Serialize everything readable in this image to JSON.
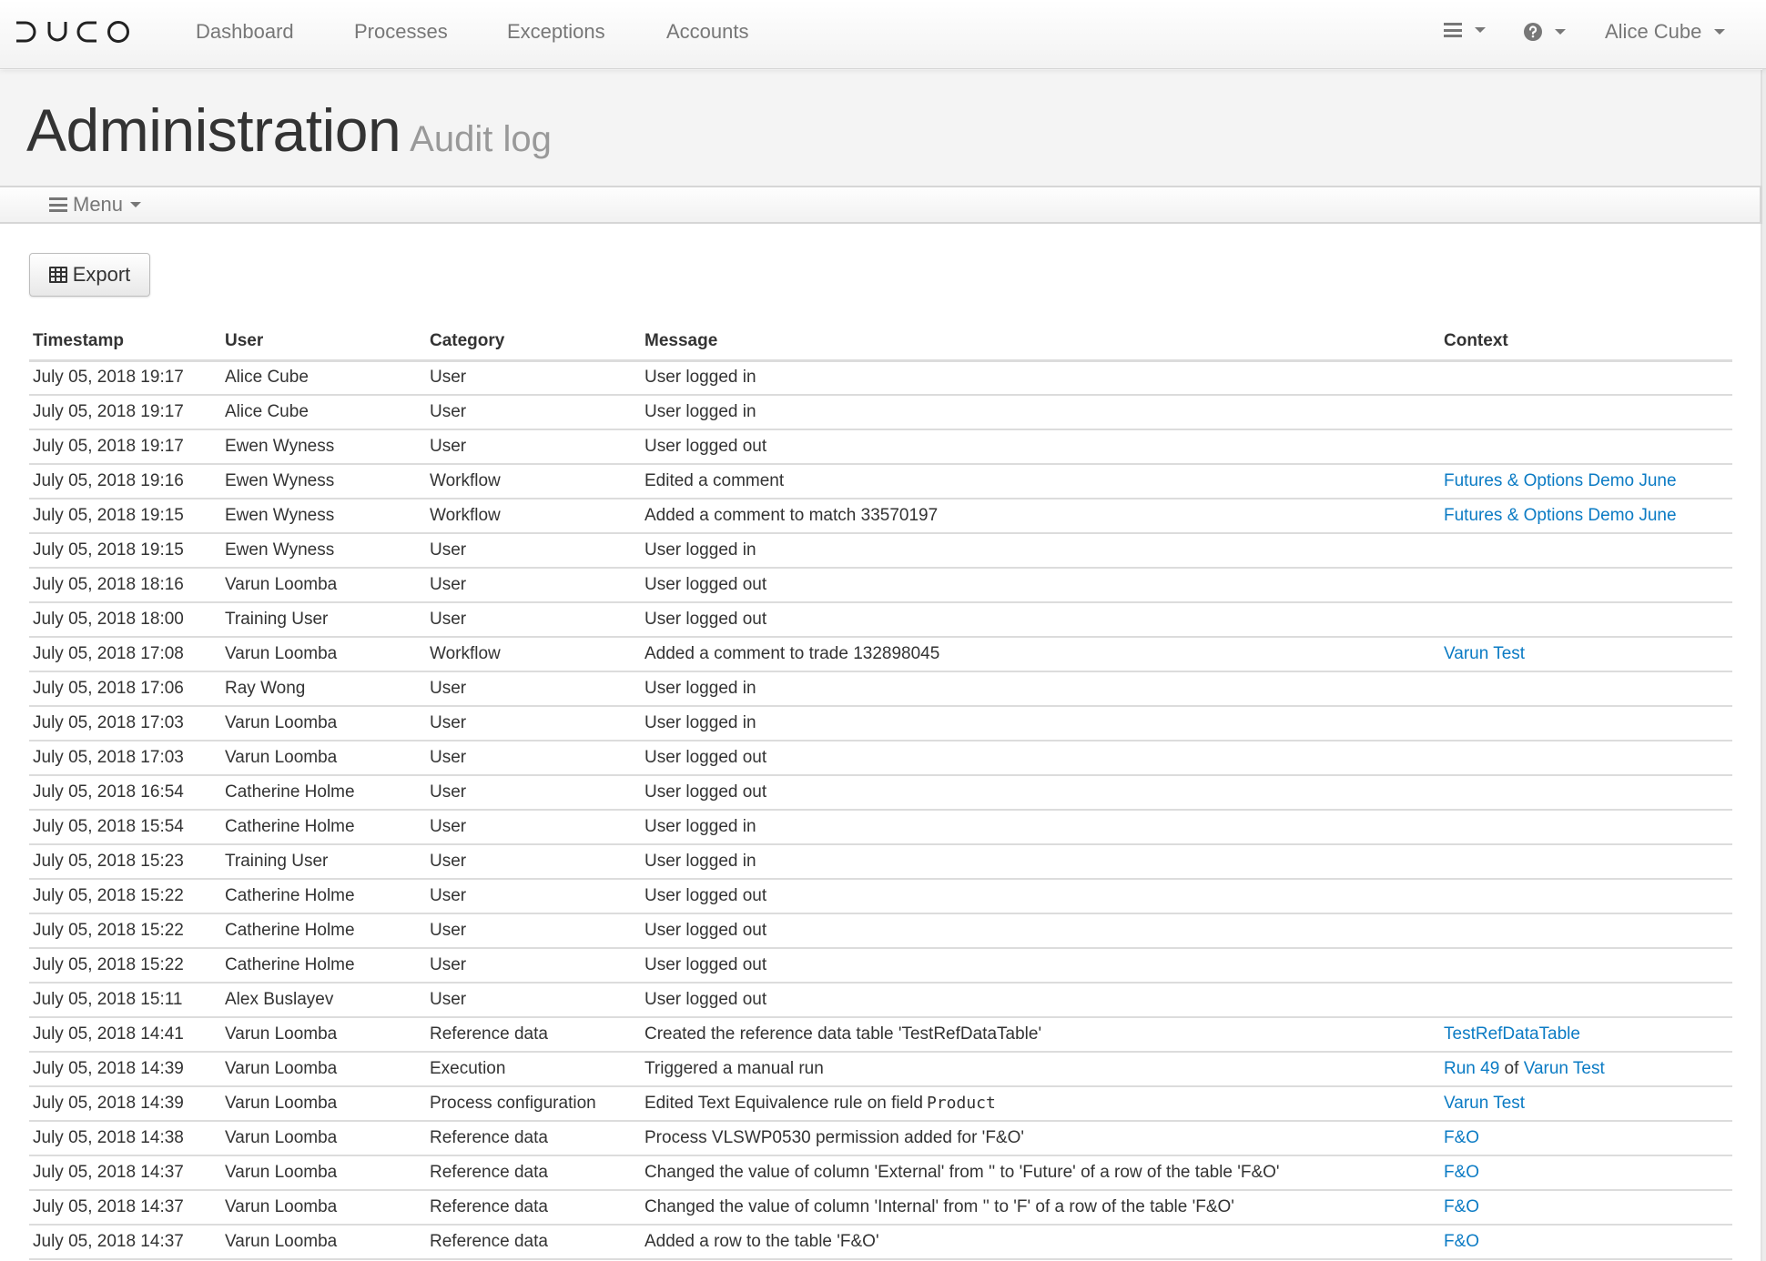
{
  "navbar": {
    "logo": "DUCO",
    "items": [
      "Dashboard",
      "Processes",
      "Exceptions",
      "Accounts"
    ],
    "right": {
      "menu_icon": "hamburger-icon",
      "help_icon": "question-circle-icon",
      "user_name": "Alice Cube"
    }
  },
  "page": {
    "title": "Administration",
    "subtitle": "Audit log"
  },
  "menubar": {
    "label": "Menu"
  },
  "toolbar": {
    "export_label": "Export",
    "export_icon": "table-icon"
  },
  "colors": {
    "link": "#0b7bc4",
    "text": "#333333",
    "nav_text": "#777777"
  },
  "table": {
    "columns": [
      "Timestamp",
      "User",
      "Category",
      "Message",
      "Context"
    ],
    "rows": [
      {
        "timestamp": "July 05, 2018 19:17",
        "user": "Alice Cube",
        "category": "User",
        "message": "User logged in",
        "context": []
      },
      {
        "timestamp": "July 05, 2018 19:17",
        "user": "Alice Cube",
        "category": "User",
        "message": "User logged in",
        "context": []
      },
      {
        "timestamp": "July 05, 2018 19:17",
        "user": "Ewen Wyness",
        "category": "User",
        "message": "User logged out",
        "context": []
      },
      {
        "timestamp": "July 05, 2018 19:16",
        "user": "Ewen Wyness",
        "category": "Workflow",
        "message": "Edited a comment",
        "context": [
          {
            "text": "Futures & Options Demo June",
            "link": true
          }
        ]
      },
      {
        "timestamp": "July 05, 2018 19:15",
        "user": "Ewen Wyness",
        "category": "Workflow",
        "message": "Added a comment to match 33570197",
        "context": [
          {
            "text": "Futures & Options Demo June",
            "link": true
          }
        ]
      },
      {
        "timestamp": "July 05, 2018 19:15",
        "user": "Ewen Wyness",
        "category": "User",
        "message": "User logged in",
        "context": []
      },
      {
        "timestamp": "July 05, 2018 18:16",
        "user": "Varun Loomba",
        "category": "User",
        "message": "User logged out",
        "context": []
      },
      {
        "timestamp": "July 05, 2018 18:00",
        "user": "Training User",
        "category": "User",
        "message": "User logged out",
        "context": []
      },
      {
        "timestamp": "July 05, 2018 17:08",
        "user": "Varun Loomba",
        "category": "Workflow",
        "message": "Added a comment to trade 132898045",
        "context": [
          {
            "text": "Varun Test",
            "link": true
          }
        ]
      },
      {
        "timestamp": "July 05, 2018 17:06",
        "user": "Ray Wong",
        "category": "User",
        "message": "User logged in",
        "context": []
      },
      {
        "timestamp": "July 05, 2018 17:03",
        "user": "Varun Loomba",
        "category": "User",
        "message": "User logged in",
        "context": []
      },
      {
        "timestamp": "July 05, 2018 17:03",
        "user": "Varun Loomba",
        "category": "User",
        "message": "User logged out",
        "context": []
      },
      {
        "timestamp": "July 05, 2018 16:54",
        "user": "Catherine Holme",
        "category": "User",
        "message": "User logged out",
        "context": []
      },
      {
        "timestamp": "July 05, 2018 15:54",
        "user": "Catherine Holme",
        "category": "User",
        "message": "User logged in",
        "context": []
      },
      {
        "timestamp": "July 05, 2018 15:23",
        "user": "Training User",
        "category": "User",
        "message": "User logged in",
        "context": []
      },
      {
        "timestamp": "July 05, 2018 15:22",
        "user": "Catherine Holme",
        "category": "User",
        "message": "User logged out",
        "context": []
      },
      {
        "timestamp": "July 05, 2018 15:22",
        "user": "Catherine Holme",
        "category": "User",
        "message": "User logged out",
        "context": []
      },
      {
        "timestamp": "July 05, 2018 15:22",
        "user": "Catherine Holme",
        "category": "User",
        "message": "User logged out",
        "context": []
      },
      {
        "timestamp": "July 05, 2018 15:11",
        "user": "Alex Buslayev",
        "category": "User",
        "message": "User logged out",
        "context": []
      },
      {
        "timestamp": "July 05, 2018 14:41",
        "user": "Varun Loomba",
        "category": "Reference data",
        "message": "Created the reference data table 'TestRefDataTable'",
        "context": [
          {
            "text": "TestRefDataTable",
            "link": true
          }
        ]
      },
      {
        "timestamp": "July 05, 2018 14:39",
        "user": "Varun Loomba",
        "category": "Execution",
        "message": "Triggered a manual run",
        "context": [
          {
            "text": "Run 49",
            "link": true
          },
          {
            "text": " of ",
            "link": false
          },
          {
            "text": "Varun Test",
            "link": true
          }
        ]
      },
      {
        "timestamp": "July 05, 2018 14:39",
        "user": "Varun Loomba",
        "category": "Process configuration",
        "message": "Edited Text Equivalence rule on field",
        "message_code": "Product",
        "context": [
          {
            "text": "Varun Test",
            "link": true
          }
        ]
      },
      {
        "timestamp": "July 05, 2018 14:38",
        "user": "Varun Loomba",
        "category": "Reference data",
        "message": "Process VLSWP0530 permission added for 'F&O'",
        "context": [
          {
            "text": "F&O",
            "link": true
          }
        ]
      },
      {
        "timestamp": "July 05, 2018 14:37",
        "user": "Varun Loomba",
        "category": "Reference data",
        "message": "Changed the value of column 'External' from '' to 'Future' of a row of the table 'F&O'",
        "context": [
          {
            "text": "F&O",
            "link": true
          }
        ]
      },
      {
        "timestamp": "July 05, 2018 14:37",
        "user": "Varun Loomba",
        "category": "Reference data",
        "message": "Changed the value of column 'Internal' from '' to 'F' of a row of the table 'F&O'",
        "context": [
          {
            "text": "F&O",
            "link": true
          }
        ]
      },
      {
        "timestamp": "July 05, 2018 14:37",
        "user": "Varun Loomba",
        "category": "Reference data",
        "message": "Added a row to the table 'F&O'",
        "context": [
          {
            "text": "F&O",
            "link": true
          }
        ]
      }
    ]
  }
}
